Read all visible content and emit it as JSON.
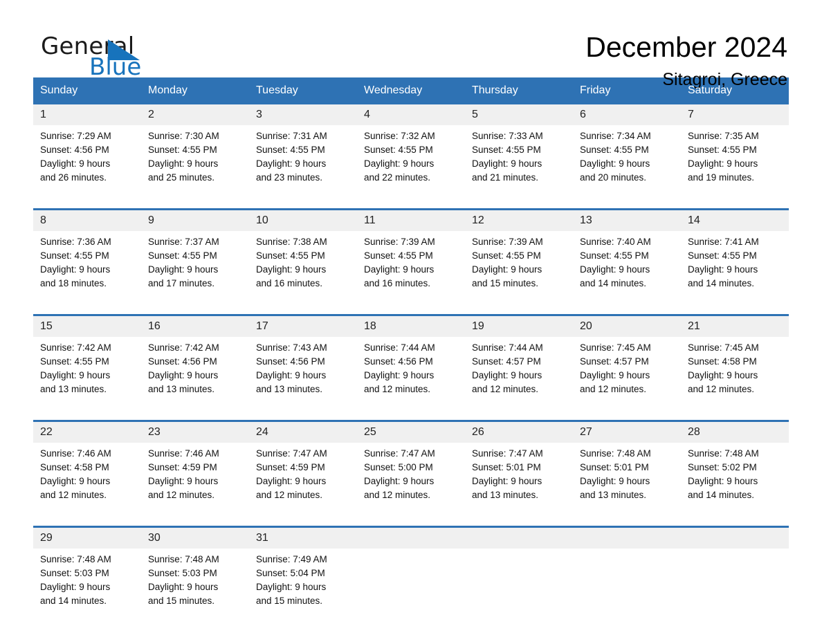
{
  "brand": {
    "name_part1": "General",
    "name_part2": "Blue",
    "accent_color": "#1773bc"
  },
  "header": {
    "title": "December 2024",
    "location": "Sitagroi, Greece"
  },
  "theme": {
    "header_blue": "#2e72b4",
    "daynum_background": "#f0f0f0",
    "page_background": "#ffffff"
  },
  "calendar": {
    "weekday_headers": [
      "Sunday",
      "Monday",
      "Tuesday",
      "Wednesday",
      "Thursday",
      "Friday",
      "Saturday"
    ],
    "weeks": [
      {
        "days": [
          {
            "date": "1",
            "sunrise": "Sunrise: 7:29 AM",
            "sunset": "Sunset: 4:56 PM",
            "daylight_line1": "Daylight: 9 hours",
            "daylight_line2": "and 26 minutes."
          },
          {
            "date": "2",
            "sunrise": "Sunrise: 7:30 AM",
            "sunset": "Sunset: 4:55 PM",
            "daylight_line1": "Daylight: 9 hours",
            "daylight_line2": "and 25 minutes."
          },
          {
            "date": "3",
            "sunrise": "Sunrise: 7:31 AM",
            "sunset": "Sunset: 4:55 PM",
            "daylight_line1": "Daylight: 9 hours",
            "daylight_line2": "and 23 minutes."
          },
          {
            "date": "4",
            "sunrise": "Sunrise: 7:32 AM",
            "sunset": "Sunset: 4:55 PM",
            "daylight_line1": "Daylight: 9 hours",
            "daylight_line2": "and 22 minutes."
          },
          {
            "date": "5",
            "sunrise": "Sunrise: 7:33 AM",
            "sunset": "Sunset: 4:55 PM",
            "daylight_line1": "Daylight: 9 hours",
            "daylight_line2": "and 21 minutes."
          },
          {
            "date": "6",
            "sunrise": "Sunrise: 7:34 AM",
            "sunset": "Sunset: 4:55 PM",
            "daylight_line1": "Daylight: 9 hours",
            "daylight_line2": "and 20 minutes."
          },
          {
            "date": "7",
            "sunrise": "Sunrise: 7:35 AM",
            "sunset": "Sunset: 4:55 PM",
            "daylight_line1": "Daylight: 9 hours",
            "daylight_line2": "and 19 minutes."
          }
        ]
      },
      {
        "days": [
          {
            "date": "8",
            "sunrise": "Sunrise: 7:36 AM",
            "sunset": "Sunset: 4:55 PM",
            "daylight_line1": "Daylight: 9 hours",
            "daylight_line2": "and 18 minutes."
          },
          {
            "date": "9",
            "sunrise": "Sunrise: 7:37 AM",
            "sunset": "Sunset: 4:55 PM",
            "daylight_line1": "Daylight: 9 hours",
            "daylight_line2": "and 17 minutes."
          },
          {
            "date": "10",
            "sunrise": "Sunrise: 7:38 AM",
            "sunset": "Sunset: 4:55 PM",
            "daylight_line1": "Daylight: 9 hours",
            "daylight_line2": "and 16 minutes."
          },
          {
            "date": "11",
            "sunrise": "Sunrise: 7:39 AM",
            "sunset": "Sunset: 4:55 PM",
            "daylight_line1": "Daylight: 9 hours",
            "daylight_line2": "and 16 minutes."
          },
          {
            "date": "12",
            "sunrise": "Sunrise: 7:39 AM",
            "sunset": "Sunset: 4:55 PM",
            "daylight_line1": "Daylight: 9 hours",
            "daylight_line2": "and 15 minutes."
          },
          {
            "date": "13",
            "sunrise": "Sunrise: 7:40 AM",
            "sunset": "Sunset: 4:55 PM",
            "daylight_line1": "Daylight: 9 hours",
            "daylight_line2": "and 14 minutes."
          },
          {
            "date": "14",
            "sunrise": "Sunrise: 7:41 AM",
            "sunset": "Sunset: 4:55 PM",
            "daylight_line1": "Daylight: 9 hours",
            "daylight_line2": "and 14 minutes."
          }
        ]
      },
      {
        "days": [
          {
            "date": "15",
            "sunrise": "Sunrise: 7:42 AM",
            "sunset": "Sunset: 4:55 PM",
            "daylight_line1": "Daylight: 9 hours",
            "daylight_line2": "and 13 minutes."
          },
          {
            "date": "16",
            "sunrise": "Sunrise: 7:42 AM",
            "sunset": "Sunset: 4:56 PM",
            "daylight_line1": "Daylight: 9 hours",
            "daylight_line2": "and 13 minutes."
          },
          {
            "date": "17",
            "sunrise": "Sunrise: 7:43 AM",
            "sunset": "Sunset: 4:56 PM",
            "daylight_line1": "Daylight: 9 hours",
            "daylight_line2": "and 13 minutes."
          },
          {
            "date": "18",
            "sunrise": "Sunrise: 7:44 AM",
            "sunset": "Sunset: 4:56 PM",
            "daylight_line1": "Daylight: 9 hours",
            "daylight_line2": "and 12 minutes."
          },
          {
            "date": "19",
            "sunrise": "Sunrise: 7:44 AM",
            "sunset": "Sunset: 4:57 PM",
            "daylight_line1": "Daylight: 9 hours",
            "daylight_line2": "and 12 minutes."
          },
          {
            "date": "20",
            "sunrise": "Sunrise: 7:45 AM",
            "sunset": "Sunset: 4:57 PM",
            "daylight_line1": "Daylight: 9 hours",
            "daylight_line2": "and 12 minutes."
          },
          {
            "date": "21",
            "sunrise": "Sunrise: 7:45 AM",
            "sunset": "Sunset: 4:58 PM",
            "daylight_line1": "Daylight: 9 hours",
            "daylight_line2": "and 12 minutes."
          }
        ]
      },
      {
        "days": [
          {
            "date": "22",
            "sunrise": "Sunrise: 7:46 AM",
            "sunset": "Sunset: 4:58 PM",
            "daylight_line1": "Daylight: 9 hours",
            "daylight_line2": "and 12 minutes."
          },
          {
            "date": "23",
            "sunrise": "Sunrise: 7:46 AM",
            "sunset": "Sunset: 4:59 PM",
            "daylight_line1": "Daylight: 9 hours",
            "daylight_line2": "and 12 minutes."
          },
          {
            "date": "24",
            "sunrise": "Sunrise: 7:47 AM",
            "sunset": "Sunset: 4:59 PM",
            "daylight_line1": "Daylight: 9 hours",
            "daylight_line2": "and 12 minutes."
          },
          {
            "date": "25",
            "sunrise": "Sunrise: 7:47 AM",
            "sunset": "Sunset: 5:00 PM",
            "daylight_line1": "Daylight: 9 hours",
            "daylight_line2": "and 12 minutes."
          },
          {
            "date": "26",
            "sunrise": "Sunrise: 7:47 AM",
            "sunset": "Sunset: 5:01 PM",
            "daylight_line1": "Daylight: 9 hours",
            "daylight_line2": "and 13 minutes."
          },
          {
            "date": "27",
            "sunrise": "Sunrise: 7:48 AM",
            "sunset": "Sunset: 5:01 PM",
            "daylight_line1": "Daylight: 9 hours",
            "daylight_line2": "and 13 minutes."
          },
          {
            "date": "28",
            "sunrise": "Sunrise: 7:48 AM",
            "sunset": "Sunset: 5:02 PM",
            "daylight_line1": "Daylight: 9 hours",
            "daylight_line2": "and 14 minutes."
          }
        ]
      },
      {
        "days": [
          {
            "date": "29",
            "sunrise": "Sunrise: 7:48 AM",
            "sunset": "Sunset: 5:03 PM",
            "daylight_line1": "Daylight: 9 hours",
            "daylight_line2": "and 14 minutes."
          },
          {
            "date": "30",
            "sunrise": "Sunrise: 7:48 AM",
            "sunset": "Sunset: 5:03 PM",
            "daylight_line1": "Daylight: 9 hours",
            "daylight_line2": "and 15 minutes."
          },
          {
            "date": "31",
            "sunrise": "Sunrise: 7:49 AM",
            "sunset": "Sunset: 5:04 PM",
            "daylight_line1": "Daylight: 9 hours",
            "daylight_line2": "and 15 minutes."
          },
          {
            "date": "",
            "sunrise": "",
            "sunset": "",
            "daylight_line1": "",
            "daylight_line2": ""
          },
          {
            "date": "",
            "sunrise": "",
            "sunset": "",
            "daylight_line1": "",
            "daylight_line2": ""
          },
          {
            "date": "",
            "sunrise": "",
            "sunset": "",
            "daylight_line1": "",
            "daylight_line2": ""
          },
          {
            "date": "",
            "sunrise": "",
            "sunset": "",
            "daylight_line1": "",
            "daylight_line2": ""
          }
        ]
      }
    ]
  }
}
